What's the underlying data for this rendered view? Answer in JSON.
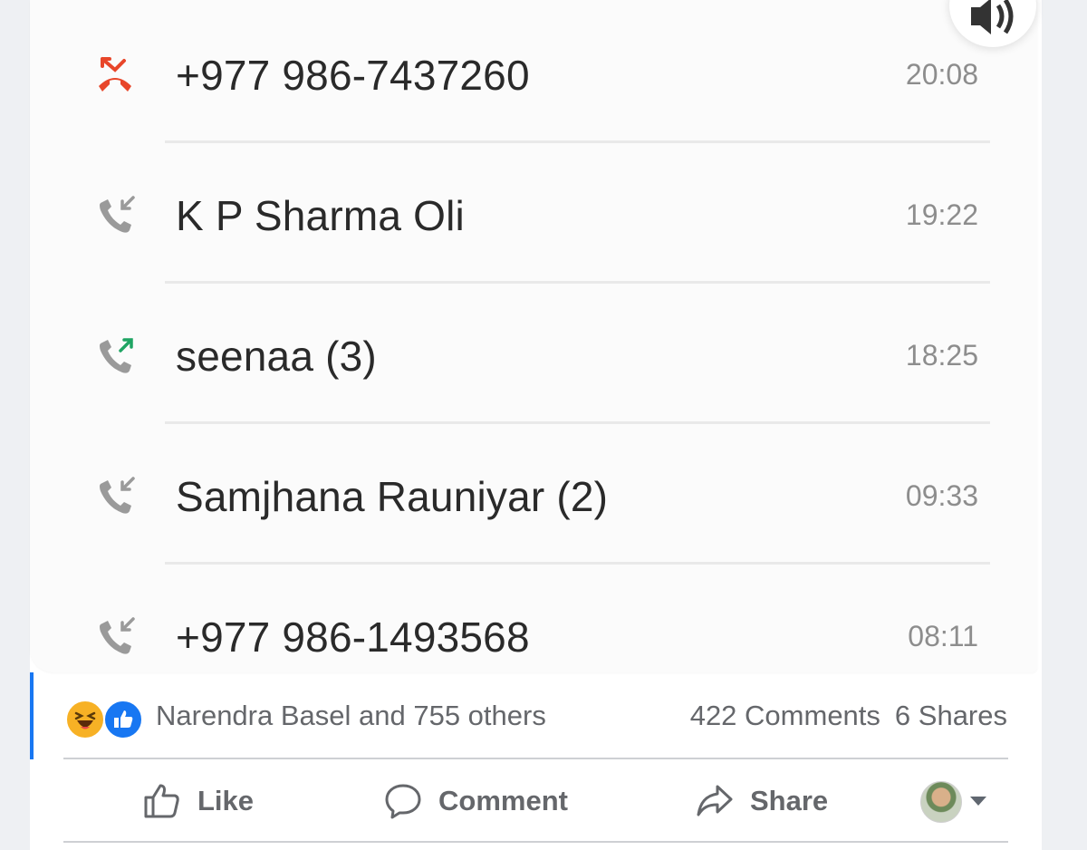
{
  "call_log": [
    {
      "name": "+977 986-7437260",
      "time": "20:08",
      "type": "missed",
      "icon": "missed-call-icon"
    },
    {
      "name": "K P Sharma Oli",
      "time": "19:22",
      "type": "incoming",
      "icon": "incoming-call-icon"
    },
    {
      "name": "seenaa (3)",
      "time": "18:25",
      "type": "outgoing",
      "icon": "outgoing-call-icon"
    },
    {
      "name": "Samjhana Rauniyar (2)",
      "time": "09:33",
      "type": "incoming",
      "icon": "incoming-call-icon"
    },
    {
      "name": "+977 986-1493568",
      "time": "08:11",
      "type": "incoming",
      "icon": "incoming-call-icon"
    }
  ],
  "post_summary": {
    "reactions_text": "Narendra Basel and 755 others",
    "comments": "422 Comments",
    "shares": "6 Shares",
    "reaction_icons": [
      "haha-reaction-icon",
      "like-reaction-icon"
    ]
  },
  "actions": {
    "like": "Like",
    "comment": "Comment",
    "share": "Share"
  },
  "colors": {
    "missed": "#e8462a",
    "outgoing": "#1fa463",
    "neutral": "#9a9a9a",
    "facebook_blue": "#1877f2"
  }
}
